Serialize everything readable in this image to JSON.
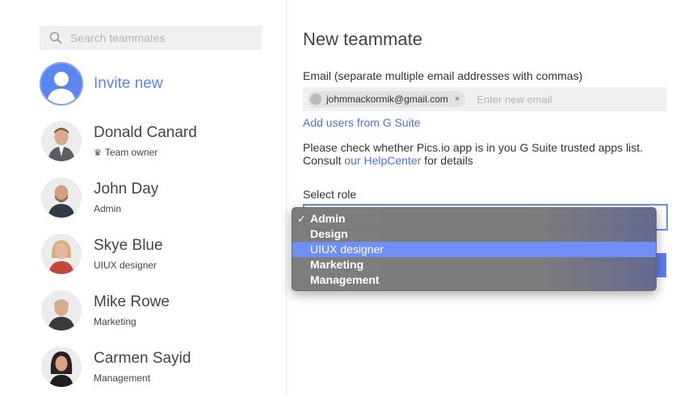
{
  "search": {
    "placeholder": "Search teammates"
  },
  "invite": {
    "label": "Invite new"
  },
  "members": [
    {
      "name": "Donald Canard",
      "role": "Team owner",
      "crown": "♛"
    },
    {
      "name": "John Day",
      "role": "Admin"
    },
    {
      "name": "Skye Blue",
      "role": "UIUX designer"
    },
    {
      "name": "Mike Rowe",
      "role": "Marketing"
    },
    {
      "name": "Carmen Sayid",
      "role": "Management"
    }
  ],
  "form": {
    "title": "New teammate",
    "email_label": "Email (separate multiple email addresses with commas)",
    "chip_email": "johmmackormik@gmail.com",
    "chip_remove": "×",
    "email_placeholder": "Enter new email",
    "gsuite_link": "Add users from G Suite",
    "note_line1": "Please check whether Pics.io app is in you G Suite trusted apps list.",
    "note_consult": "Consult",
    "note_help_link": "our HelpCenter",
    "note_tail": "for details",
    "role_label": "Select role"
  },
  "dropdown": {
    "options": [
      "Admin",
      "Design",
      "UIUX designer",
      "Marketing",
      "Management"
    ],
    "checked_index": 0,
    "highlighted_index": 2,
    "check_mark": "✓"
  },
  "colors": {
    "accent": "#5b86f2",
    "link": "#4b72db",
    "highlight": "#6f8ef6"
  }
}
